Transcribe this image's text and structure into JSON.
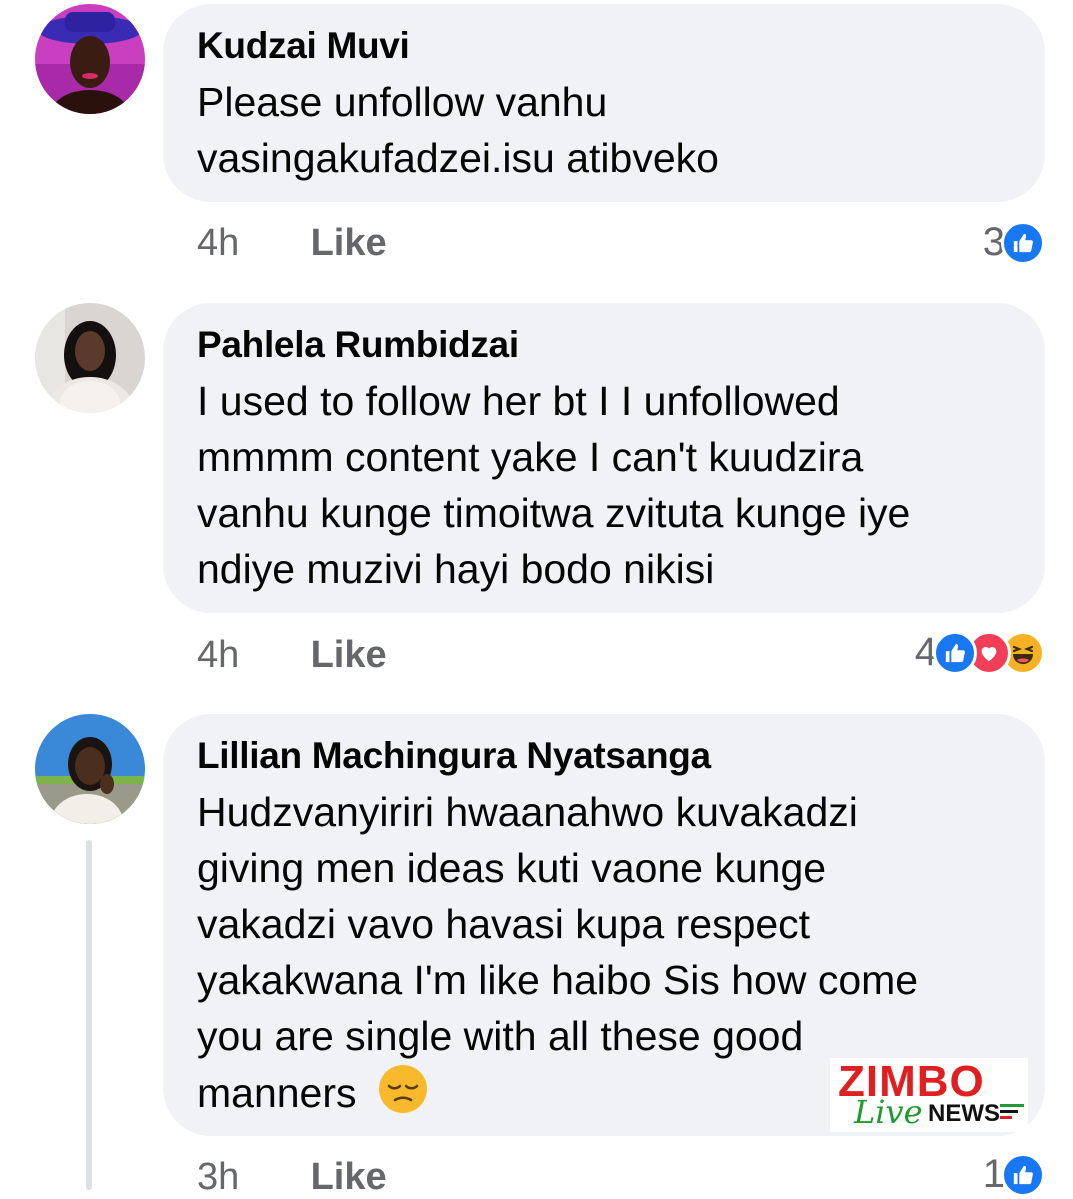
{
  "comments": [
    {
      "author": "Kudzai Muvi",
      "text_lines": [
        "Please unfollow vanhu",
        "vasingakufadzei.isu atibveko"
      ],
      "time": "4h",
      "like_label": "Like",
      "reaction_count": "3",
      "reactions": [
        "like-icon"
      ]
    },
    {
      "author": "Pahlela Rumbidzai",
      "text_lines": [
        "I used to follow her bt I I unfollowed",
        "mmmm content yake I can't kuudzira",
        "vanhu kunge timoitwa zvituta kunge iye",
        "ndiye muzivi hayi bodo nikisi"
      ],
      "time": "4h",
      "like_label": "Like",
      "reaction_count": "4",
      "reactions": [
        "like-icon",
        "love-icon",
        "haha-icon"
      ]
    },
    {
      "author": "Lillian Machingura Nyatsanga",
      "text_lines": [
        "Hudzvanyiriri hwaanahwo kuvakadzi",
        "giving men ideas kuti vaone kunge",
        "vakadzi vavo havasi kupa respect",
        "yakakwana I'm like haibo Sis how come",
        "you are single with all these good",
        "manners"
      ],
      "time": "3h",
      "like_label": "Like",
      "reaction_count": "1",
      "reactions": [
        "like-icon"
      ]
    }
  ],
  "watermark": {
    "brand": "ZIMBO",
    "live": "Live",
    "news": "NEWS"
  },
  "colors": {
    "bubble": "#f0f2f5",
    "meta": "#65676b",
    "like_blue": "#1877f2",
    "love_red": "#f33e58",
    "haha_yellow": "#f7b125"
  }
}
